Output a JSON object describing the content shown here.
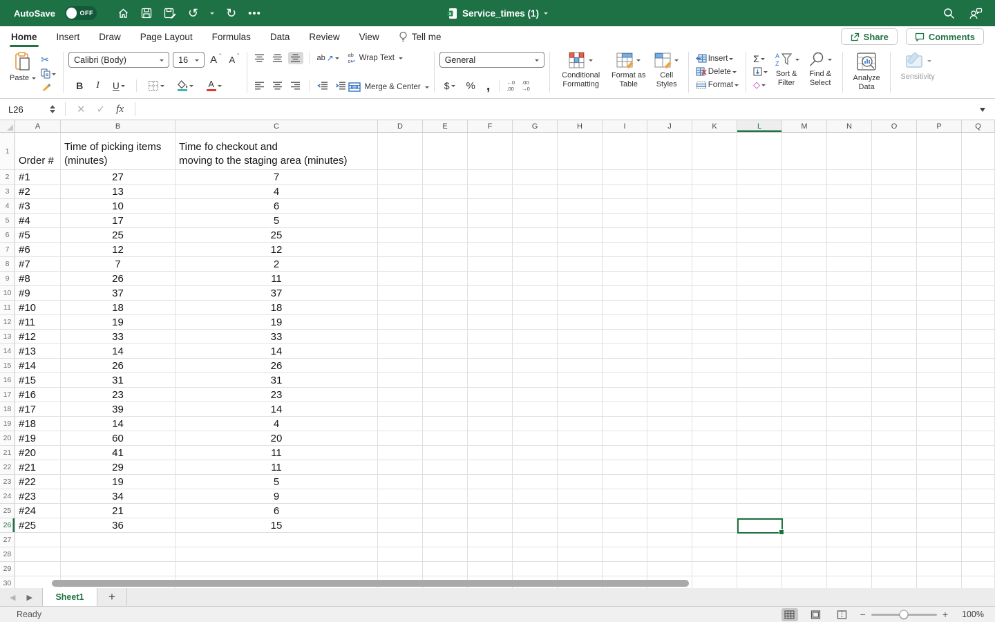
{
  "colors": {
    "accent": "#217346",
    "titlebar_green": "#1e7145",
    "selection_green": "#1a7240"
  },
  "titlebar": {
    "autosave_label": "AutoSave",
    "autosave_state": "OFF",
    "doc_title": "Service_times (1)"
  },
  "ribbon_tabs": {
    "items": [
      "Home",
      "Insert",
      "Draw",
      "Page Layout",
      "Formulas",
      "Data",
      "Review",
      "View"
    ],
    "active": "Home",
    "tell_me": "Tell me"
  },
  "top_actions": {
    "share": "Share",
    "comments": "Comments"
  },
  "ribbon": {
    "paste": "Paste",
    "font_name": "Calibri (Body)",
    "font_size": "16",
    "bold": "B",
    "italic": "I",
    "underline": "U",
    "orientation_ab": "ab",
    "wrap_text": "Wrap Text",
    "merge_center": "Merge & Center",
    "number_format": "General",
    "currency": "$",
    "percent": "%",
    "comma": ",",
    "conditional_formatting": "Conditional Formatting",
    "format_as_table": "Format as Table",
    "cell_styles": "Cell Styles",
    "insert": "Insert",
    "delete": "Delete",
    "format": "Format",
    "sum": "Σ",
    "sort_filter": "Sort & Filter",
    "find_select": "Find & Select",
    "analyze_data": "Analyze Data",
    "sensitivity": "Sensitivity"
  },
  "formula_bar": {
    "name_box": "L26",
    "fx": "fx"
  },
  "sheet": {
    "columns": [
      "A",
      "B",
      "C",
      "D",
      "E",
      "F",
      "G",
      "H",
      "I",
      "J",
      "K",
      "L",
      "M",
      "N",
      "O",
      "P",
      "Q"
    ],
    "selected_column": "L",
    "selected_row": 26,
    "selected_cell": "L26",
    "total_rows": 30,
    "header_a": "Order #",
    "header_b": "Time of picking items\n(minutes)",
    "header_c": "Time fo checkout and\nmoving to the staging area (minutes)",
    "orders": [
      {
        "order": "#1",
        "picking": 27,
        "checkout": 7
      },
      {
        "order": "#2",
        "picking": 13,
        "checkout": 4
      },
      {
        "order": "#3",
        "picking": 10,
        "checkout": 6
      },
      {
        "order": "#4",
        "picking": 17,
        "checkout": 5
      },
      {
        "order": "#5",
        "picking": 25,
        "checkout": 25
      },
      {
        "order": "#6",
        "picking": 12,
        "checkout": 12
      },
      {
        "order": "#7",
        "picking": 7,
        "checkout": 2
      },
      {
        "order": "#8",
        "picking": 26,
        "checkout": 11
      },
      {
        "order": "#9",
        "picking": 37,
        "checkout": 37
      },
      {
        "order": "#10",
        "picking": 18,
        "checkout": 18
      },
      {
        "order": "#11",
        "picking": 19,
        "checkout": 19
      },
      {
        "order": "#12",
        "picking": 33,
        "checkout": 33
      },
      {
        "order": "#13",
        "picking": 14,
        "checkout": 14
      },
      {
        "order": "#14",
        "picking": 26,
        "checkout": 26
      },
      {
        "order": "#15",
        "picking": 31,
        "checkout": 31
      },
      {
        "order": "#16",
        "picking": 23,
        "checkout": 23
      },
      {
        "order": "#17",
        "picking": 39,
        "checkout": 14
      },
      {
        "order": "#18",
        "picking": 14,
        "checkout": 4
      },
      {
        "order": "#19",
        "picking": 60,
        "checkout": 20
      },
      {
        "order": "#20",
        "picking": 41,
        "checkout": 11
      },
      {
        "order": "#21",
        "picking": 29,
        "checkout": 11
      },
      {
        "order": "#22",
        "picking": 19,
        "checkout": 5
      },
      {
        "order": "#23",
        "picking": 34,
        "checkout": 9
      },
      {
        "order": "#24",
        "picking": 21,
        "checkout": 6
      },
      {
        "order": "#25",
        "picking": 36,
        "checkout": 15
      }
    ]
  },
  "sheet_tabs": {
    "active": "Sheet1",
    "add_label": "+"
  },
  "status_bar": {
    "ready": "Ready",
    "zoom_level": "100%"
  }
}
